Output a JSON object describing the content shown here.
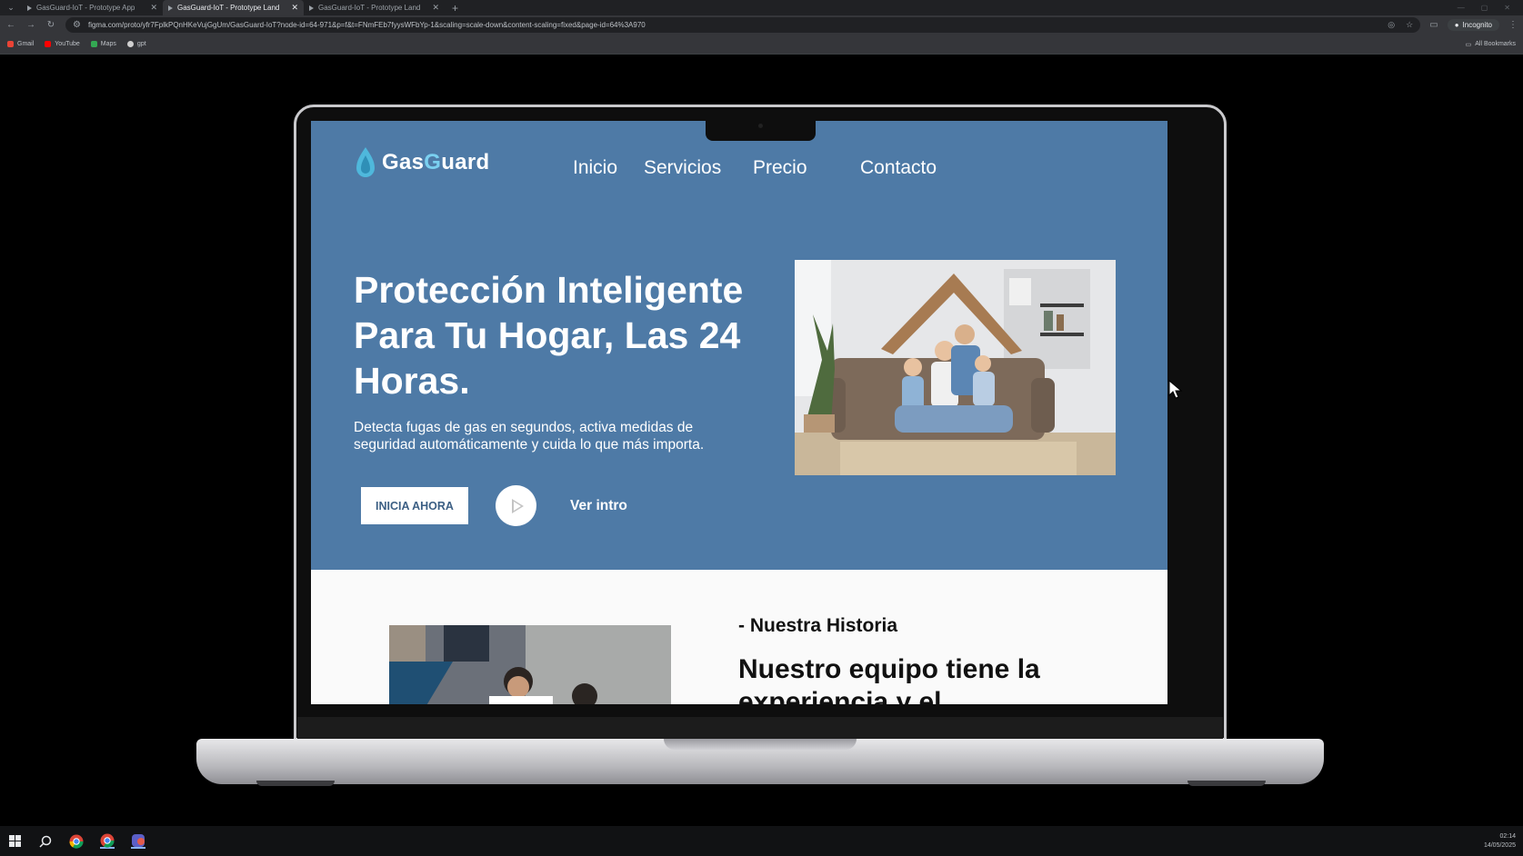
{
  "browser": {
    "tabs": [
      {
        "label": "GasGuard-IoT - Prototype App",
        "active": false
      },
      {
        "label": "GasGuard-IoT - Prototype Land",
        "active": true
      },
      {
        "label": "GasGuard-IoT - Prototype Land",
        "active": false
      }
    ],
    "url": "figma.com/proto/yfr7FplkPQnHKeVujGgUm/GasGuard-IoT?node-id=64-971&p=f&t=FNmFEb7fyysWFbYp-1&scaling=scale-down&content-scaling=fixed&page-id=64%3A970",
    "incognito_label": "Incognito",
    "bookmarks": [
      {
        "label": "Gmail",
        "color": "#ea4335"
      },
      {
        "label": "YouTube",
        "color": "#ff0000"
      },
      {
        "label": "Maps",
        "color": "#34a853"
      },
      {
        "label": "gpt",
        "color": "#d0d0d0"
      }
    ],
    "all_bookmarks_label": "All Bookmarks"
  },
  "site": {
    "logo": {
      "part1": "Gas",
      "part2": "G",
      "part3": "uard"
    },
    "nav": {
      "inicio": "Inicio",
      "servicios": "Servicios",
      "precio": "Precio",
      "contacto": "Contacto"
    },
    "hero": {
      "title": "Protección Inteligente Para Tu Hogar, Las 24 Horas.",
      "subtitle": "Detecta fugas de gas en segundos, activa medidas de seguridad automáticamente y cuida lo que más importa.",
      "cta_label": "INICIA AHORA",
      "intro_label": "Ver intro"
    },
    "history": {
      "label": "- Nuestra Historia",
      "title": "Nuestro equipo tiene la experiencia y el"
    }
  },
  "taskbar": {
    "time": "02:14",
    "date": "14/05/2025"
  },
  "colors": {
    "hero_bg": "#4e7aa6",
    "logo_accent": "#7ad0f0",
    "cta_text": "#3c5f84"
  }
}
